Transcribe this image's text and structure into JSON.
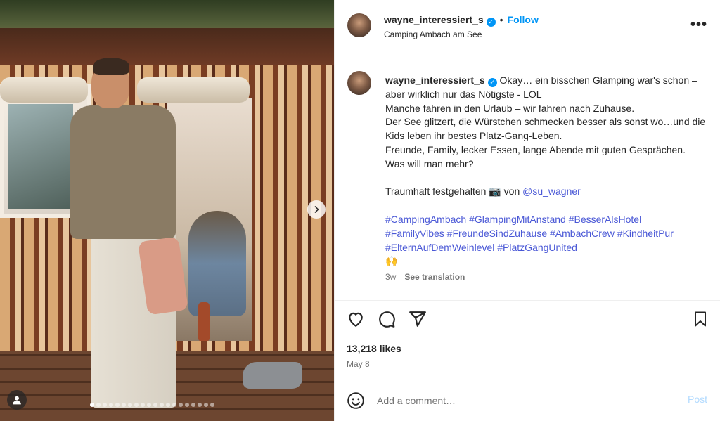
{
  "photo": {
    "carousel_total": 20,
    "carousel_active_index": 1
  },
  "header": {
    "username": "wayne_interessiert_s",
    "separator": "•",
    "follow_label": "Follow",
    "location": "Camping Ambach am See",
    "more_label": "•••"
  },
  "caption": {
    "username": "wayne_interessiert_s",
    "text_lines": [
      "Okay… ein bisschen Glamping war's schon – aber wirklich nur das Nötigste - LOL",
      "Manche fahren in den Urlaub – wir fahren nach Zuhause.",
      "Der See glitzert, die Würstchen schmecken besser als sonst wo…und die Kids leben ihr bestes Platz-Gang-Leben.",
      "Freunde, Family, lecker Essen, lange Abende mit guten Gesprächen.",
      "Was will man mehr?"
    ],
    "credit_prefix": "Traumhaft festgehalten 📷 von ",
    "credit_mention": "@su_wagner",
    "hashtags": [
      "#CampingAmbach",
      "#GlampingMitAnstand",
      "#BesserAlsHotel",
      "#FamilyVibes",
      "#FreundeSindZuhause",
      "#AmbachCrew",
      "#KindheitPur",
      "#ElternAufDemWeinlevel",
      "#PlatzGangUnited"
    ],
    "emoji": "🙌",
    "time_ago": "3w",
    "see_translation": "See translation"
  },
  "actions": {
    "like_icon": "heart-icon",
    "comment_icon": "comment-icon",
    "share_icon": "share-icon",
    "save_icon": "bookmark-icon"
  },
  "stats": {
    "likes": "13,218 likes",
    "date": "May 8"
  },
  "comment_box": {
    "placeholder": "Add a comment…",
    "post_label": "Post"
  },
  "colors": {
    "link_blue": "#0095f6",
    "hashtag": "#4a58d6",
    "post_disabled": "#b3dbff"
  }
}
